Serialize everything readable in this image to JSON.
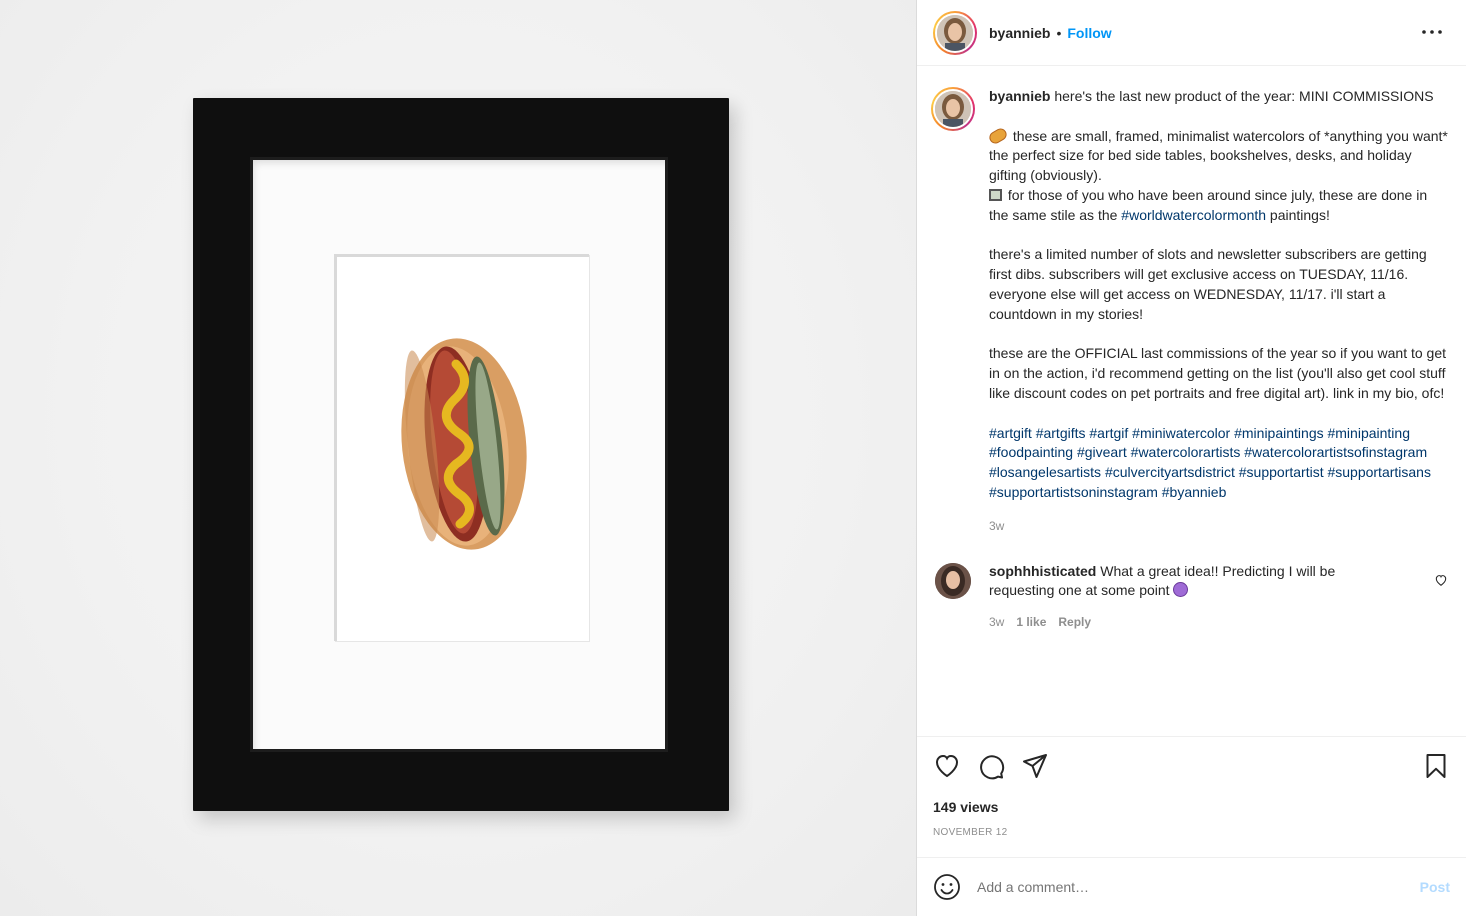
{
  "post": {
    "username": "byannieb",
    "follow_label": "Follow",
    "separator": "•",
    "more_icon": "more-horizontal-icon"
  },
  "caption": {
    "username": "byannieb",
    "intro": "here's the last new product of the year: MINI COMMISSIONS",
    "line1": "these are small, framed, minimalist watercolors of *anything you want*",
    "line2": "the perfect size for bed side tables, bookshelves, desks, and holiday gifting (obviously).",
    "line3_pre": "for those of you who have been around since july, these are done in the same stile as the ",
    "line3_tag": "#worldwatercolormonth",
    "line3_post": " paintings!",
    "para2": "there's a limited number of slots and newsletter subscribers are getting first dibs. subscribers will get exclusive access on TUESDAY, 11/16. everyone else will get access on WEDNESDAY, 11/17. i'll start a countdown in my stories!",
    "para3": "these are the OFFICIAL last commissions of the year so if you want to get in on the action, i'd recommend getting on the list (you'll also get cool stuff like discount codes on pet portraits and free digital art). link in my bio, ofc!",
    "hashtags": "#artgift #artgifts #artgif #miniwatercolor #minipaintings #minipainting #foodpainting #giveart #watercolorartists #watercolorartistsofinstagram #losangelesartists #culvercityartsdistrict #supportartist #supportartisans #supportartistsoninstagram #byannieb",
    "time": "3w"
  },
  "comment": {
    "username": "sophhhisticated",
    "text": "What a great idea!! Predicting I will be requesting one at some point",
    "time": "3w",
    "likes": "1 like",
    "reply": "Reply"
  },
  "actions": {
    "views": "149 views",
    "date": "NOVEMBER 12"
  },
  "composer": {
    "placeholder": "Add a comment…",
    "post_label": "Post"
  },
  "colors": {
    "link": "#0095f6",
    "hashtag": "#00376b",
    "muted": "#8e8e8e"
  }
}
